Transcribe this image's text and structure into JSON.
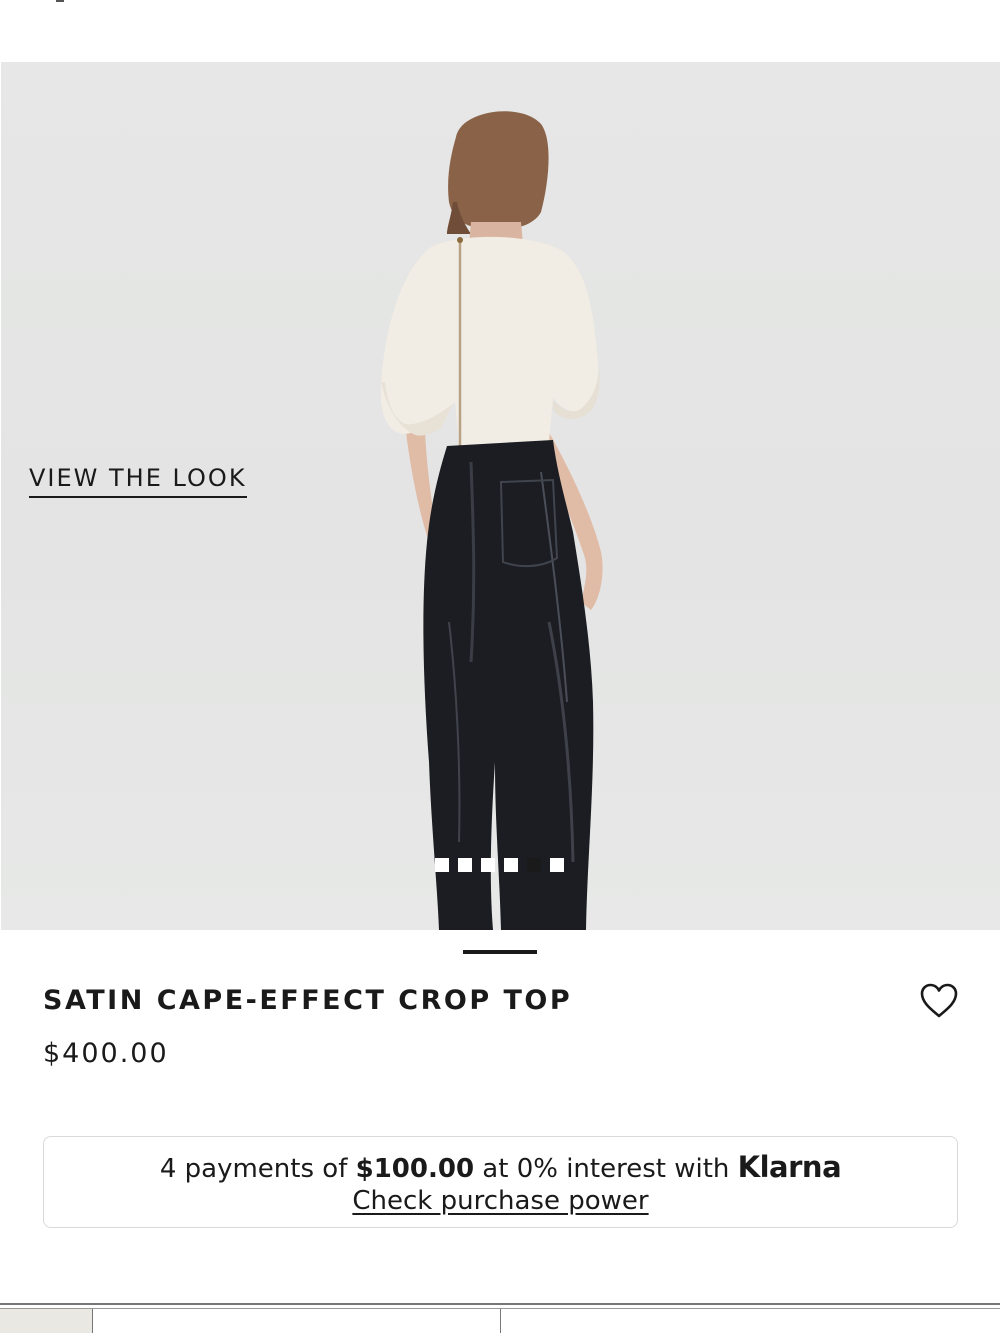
{
  "hero": {
    "view_the_look": "VIEW THE LOOK",
    "carousel": {
      "count": 6,
      "active_index": 5
    }
  },
  "product": {
    "name": "SATIN CAPE-EFFECT CROP TOP",
    "price": "$400.00"
  },
  "klarna": {
    "prefix": "4 payments of ",
    "amount": "$100.00",
    "suffix": " at 0% interest with ",
    "brand": "Klarna",
    "link": "Check purchase power"
  },
  "icons": {
    "wishlist": "heart-icon"
  }
}
